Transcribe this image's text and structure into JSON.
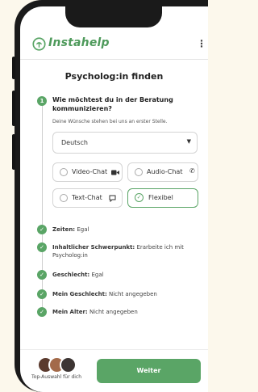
{
  "app": {
    "logo_text": "Instahelp",
    "menu_icon": "kebab-menu-icon",
    "brand_color": "#5aa566"
  },
  "page": {
    "title": "Psycholog:in finden"
  },
  "step": {
    "number": "1",
    "question": "Wie möchtest du in der Beratung kommunizieren?",
    "hint": "Deine Wünsche stehen bei uns an erster Stelle.",
    "language_select": {
      "value": "Deutsch",
      "caret_icon": "chevron-down-icon"
    },
    "options": [
      {
        "label": "Video-Chat",
        "icon": "video-camera-icon",
        "selected": false
      },
      {
        "label": "Audio-Chat",
        "icon": "phone-icon",
        "selected": false
      },
      {
        "label": "Text-Chat",
        "icon": "chat-bubble-icon",
        "selected": false
      },
      {
        "label": "Flexibel",
        "icon": "check-circle-icon",
        "selected": true
      }
    ]
  },
  "completed_steps": [
    {
      "label": "Zeiten:",
      "value": "Egal"
    },
    {
      "label": "Inhaltlicher Schwerpunkt:",
      "value": "Erarbeite ich mit Psycholog:in"
    },
    {
      "label": "Geschlecht:",
      "value": "Egal"
    },
    {
      "label": "Mein Geschlecht:",
      "value": "Nicht angegeben"
    },
    {
      "label": "Mein Alter:",
      "value": "Nicht angegeben"
    }
  ],
  "footer": {
    "caption": "Top-Auswahl für dich",
    "button_label": "Weiter"
  }
}
